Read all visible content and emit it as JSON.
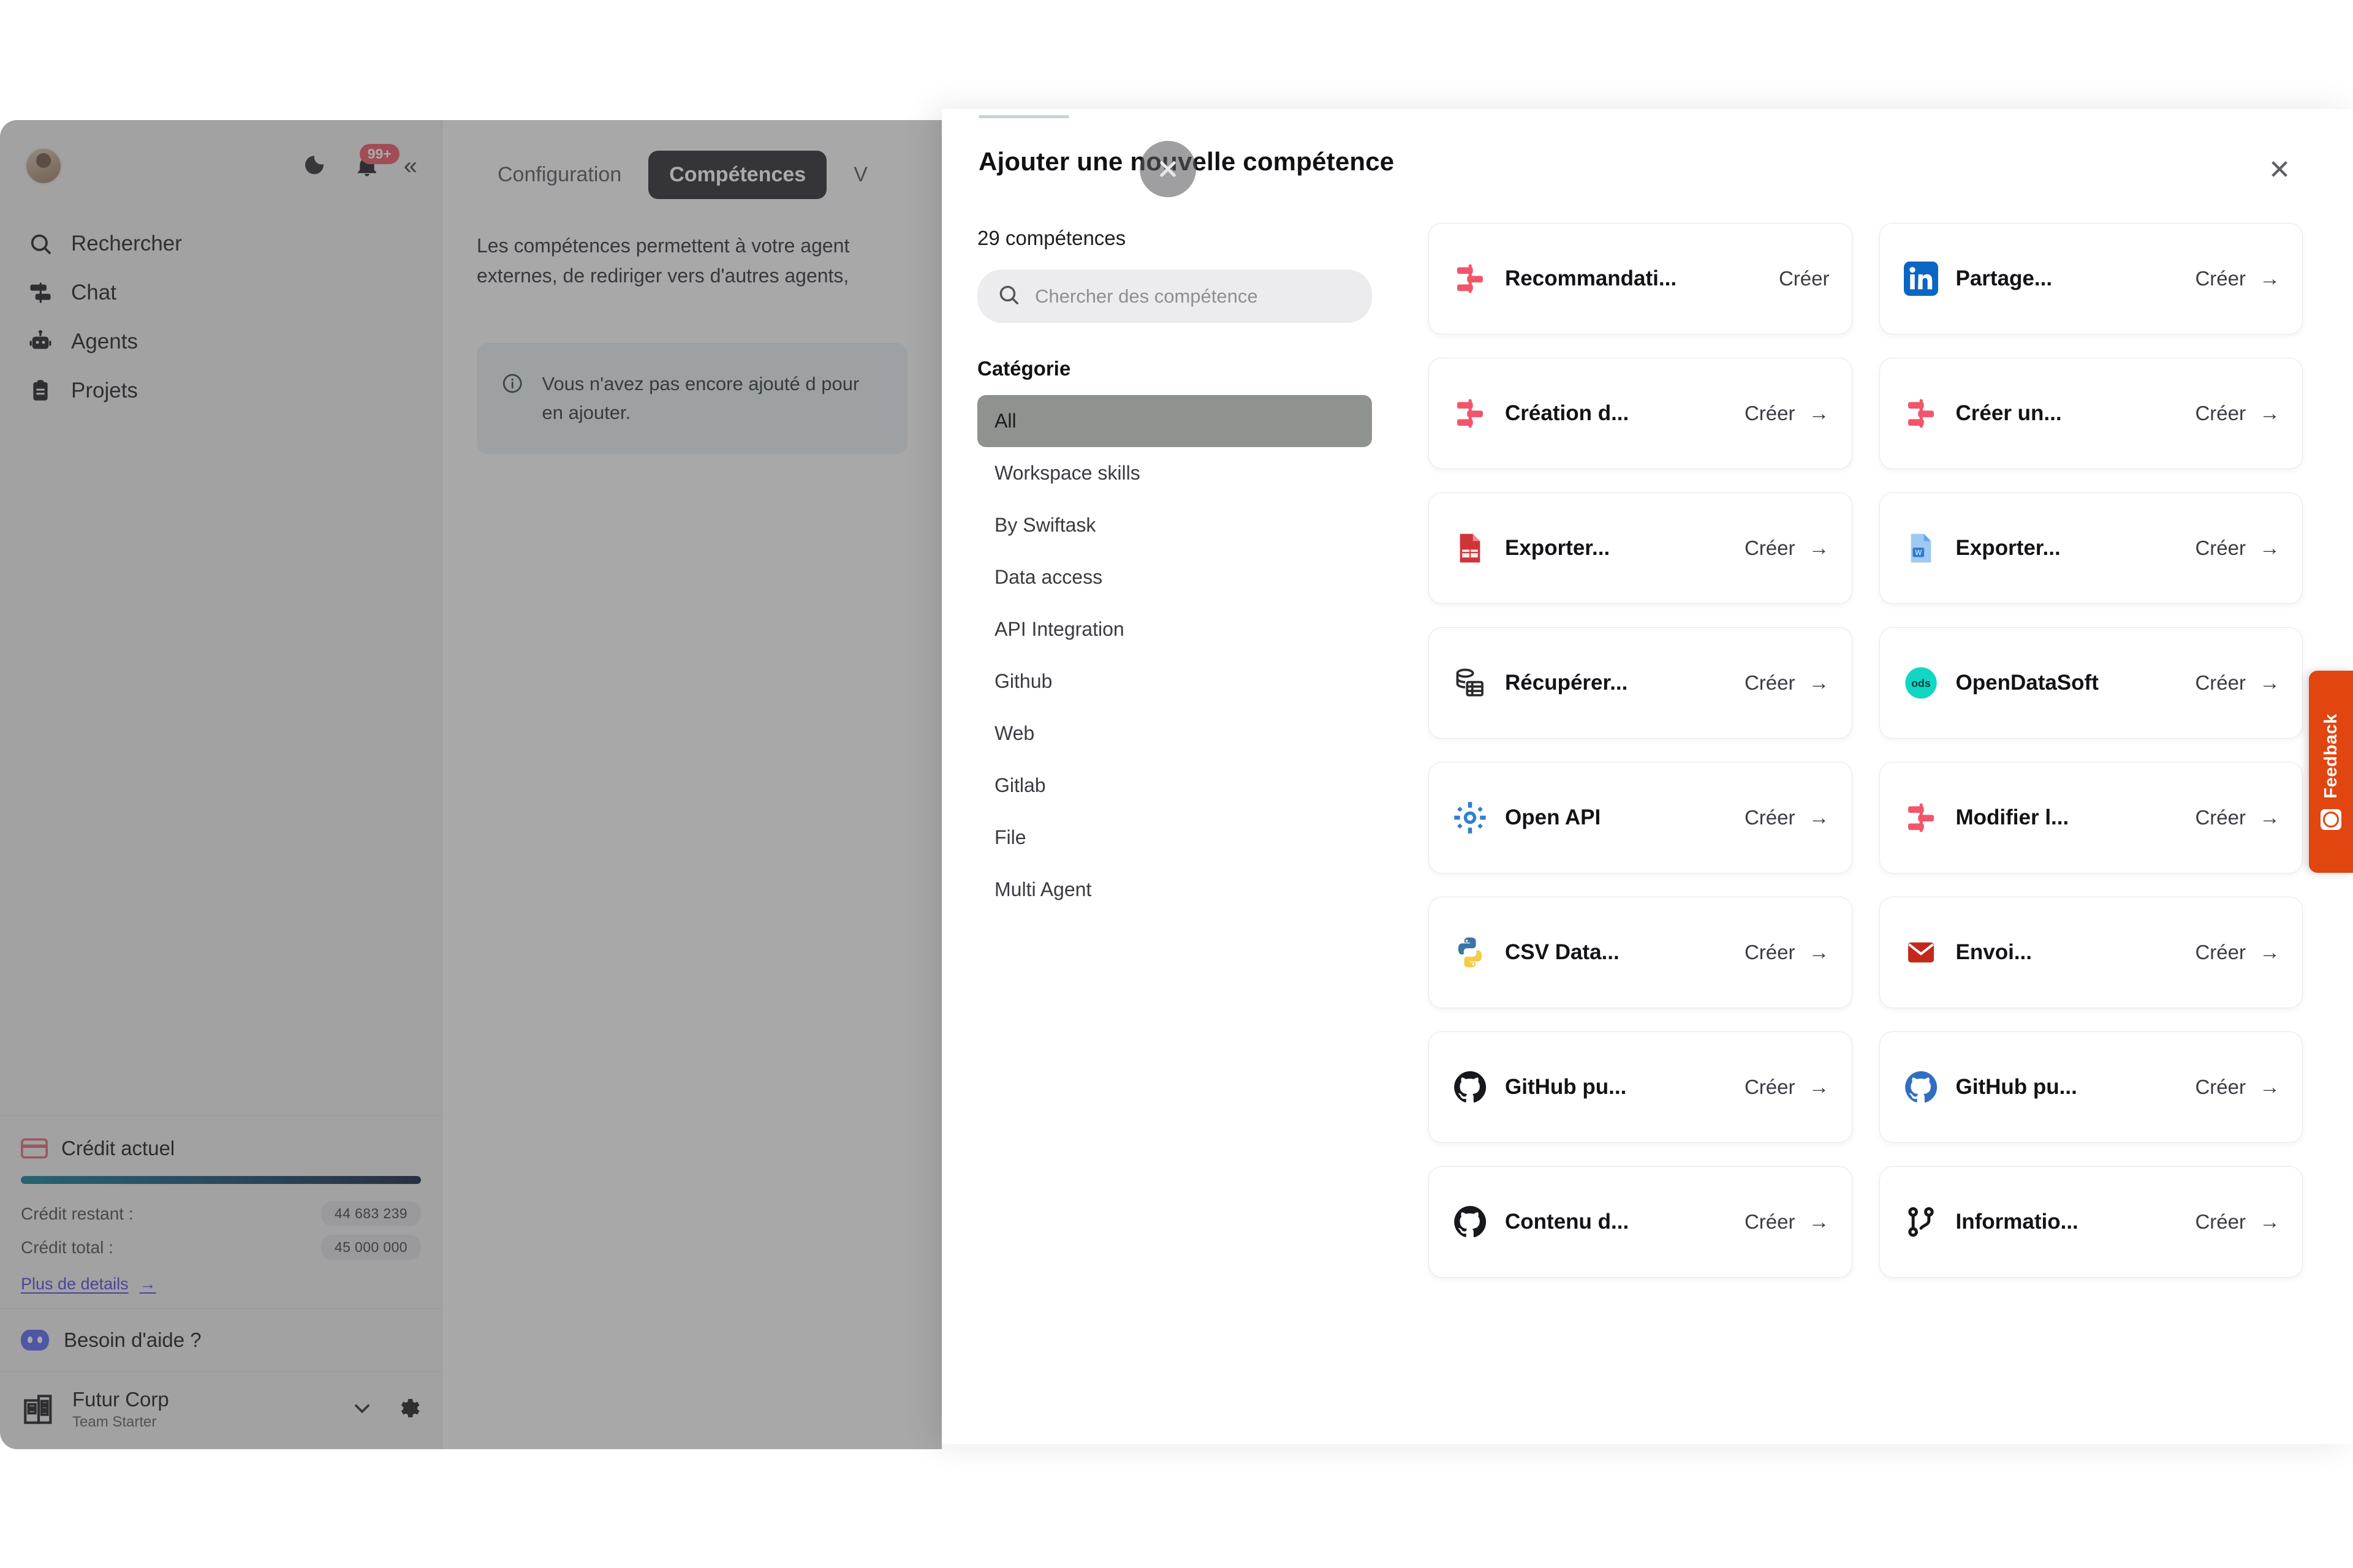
{
  "sidebar": {
    "notification_badge": "99+",
    "collapse_icon": "chevrons-left-icon",
    "nav": [
      {
        "label": "Rechercher",
        "icon": "search-icon"
      },
      {
        "label": "Chat",
        "icon": "chat-icon"
      },
      {
        "label": "Agents",
        "icon": "robot-icon"
      },
      {
        "label": "Projets",
        "icon": "clipboard-icon"
      }
    ],
    "credit": {
      "title": "Crédit actuel",
      "remaining_label": "Crédit restant :",
      "remaining_value": "44 683 239",
      "total_label": "Crédit total :",
      "total_value": "45 000 000",
      "more_details": "Plus de details",
      "bar_color": "#0d7f93"
    },
    "help_label": "Besoin d'aide ?",
    "org": {
      "name": "Futur Corp",
      "plan": "Team Starter",
      "chevron_icon": "chevron-down-icon",
      "settings_icon": "gear-icon"
    }
  },
  "main": {
    "tabs": [
      {
        "label": "Configuration",
        "active": false
      },
      {
        "label": "Compétences",
        "active": true
      },
      {
        "label": "V",
        "active": false
      }
    ],
    "description": "Les compétences permettent à votre agent\nexternes, de rediriger vers d'autres agents,",
    "info_notice": "Vous n'avez pas encore ajouté d\npour en ajouter."
  },
  "modal": {
    "title": "Ajouter une nouvelle compétence",
    "close_icon": "close-icon",
    "count_label": "29 compétences",
    "search": {
      "placeholder": "Chercher des compétence",
      "value": "",
      "icon": "search-icon"
    },
    "category_title": "Catégorie",
    "categories": [
      {
        "label": "All",
        "active": true
      },
      {
        "label": "Workspace skills",
        "active": false
      },
      {
        "label": "By Swiftask",
        "active": false
      },
      {
        "label": "Data access",
        "active": false
      },
      {
        "label": "API Integration",
        "active": false
      },
      {
        "label": "Github",
        "active": false
      },
      {
        "label": "Web",
        "active": false
      },
      {
        "label": "Gitlab",
        "active": false
      },
      {
        "label": "File",
        "active": false
      },
      {
        "label": "Multi Agent",
        "active": false
      }
    ],
    "cta_label": "Créer",
    "cta_arrow": "arrow-right-icon",
    "skills": [
      {
        "name": "Recommandati...",
        "icon": "swiftask-icon",
        "color": "#f2556a"
      },
      {
        "name": "Partage...",
        "icon": "linkedin-icon",
        "color": "#0a66c2"
      },
      {
        "name": "Création d...",
        "icon": "swiftask-icon",
        "color": "#f2556a"
      },
      {
        "name": "Créer un...",
        "icon": "swiftask-icon",
        "color": "#f2556a"
      },
      {
        "name": "Exporter...",
        "icon": "excel-file-icon",
        "color": "#d13438"
      },
      {
        "name": "Exporter...",
        "icon": "word-file-icon",
        "color": "#2b7cd3"
      },
      {
        "name": "Récupérer...",
        "icon": "database-icon",
        "color": "#2b2b30"
      },
      {
        "name": "OpenDataSoft",
        "icon": "opendatasoft-icon",
        "color": "#12d6c4"
      },
      {
        "name": "Open API",
        "icon": "openapi-icon",
        "color": "#2f7fd1"
      },
      {
        "name": "Modifier l...",
        "icon": "swiftask-icon",
        "color": "#f2556a"
      },
      {
        "name": "CSV Data...",
        "icon": "python-icon",
        "color": "#3a74a8"
      },
      {
        "name": "Envoi...",
        "icon": "mail-icon",
        "color": "#c4281c"
      },
      {
        "name": "GitHub pu...",
        "icon": "github-icon",
        "color": "#16181c"
      },
      {
        "name": "GitHub pu...",
        "icon": "github-blue-icon",
        "color": "#2f6fc2"
      },
      {
        "name": "Contenu d...",
        "icon": "github-icon",
        "color": "#16181c"
      },
      {
        "name": "Informatio...",
        "icon": "git-merge-icon",
        "color": "#16181c"
      }
    ]
  },
  "feedback": {
    "label": "Feedback",
    "icon": "smiley-icon",
    "color": "#e14510"
  }
}
